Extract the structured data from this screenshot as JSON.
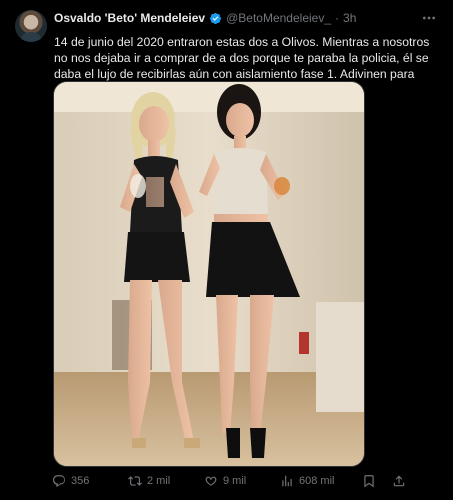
{
  "author": {
    "name": "Osvaldo 'Beto' Mendeleiev",
    "handle": "@BetoMendeleiev_",
    "separator": "·",
    "time": "3h"
  },
  "tweet": {
    "text": "14 de junio del 2020 entraron estas dos a Olivos. Mientras a nosotros no nos dejaba ir a comprar de a dos porque te paraba la policia, él se daba el lujo de recibirlas aún con aislamiento fase 1. Adivinen para qué?"
  },
  "actions": {
    "replies": "356",
    "retweets": "2 mil",
    "likes": "9 mil",
    "views": "608 mil"
  },
  "icons": {
    "verified": "verified-badge-icon",
    "more": "more-options-icon",
    "reply": "reply-icon",
    "retweet": "retweet-icon",
    "like": "heart-icon",
    "views": "views-icon",
    "bookmark": "bookmark-icon",
    "share": "share-icon"
  },
  "colors": {
    "background": "#000000",
    "text": "#e7e9ea",
    "muted": "#71767b",
    "verified": "#1d9bf0"
  }
}
